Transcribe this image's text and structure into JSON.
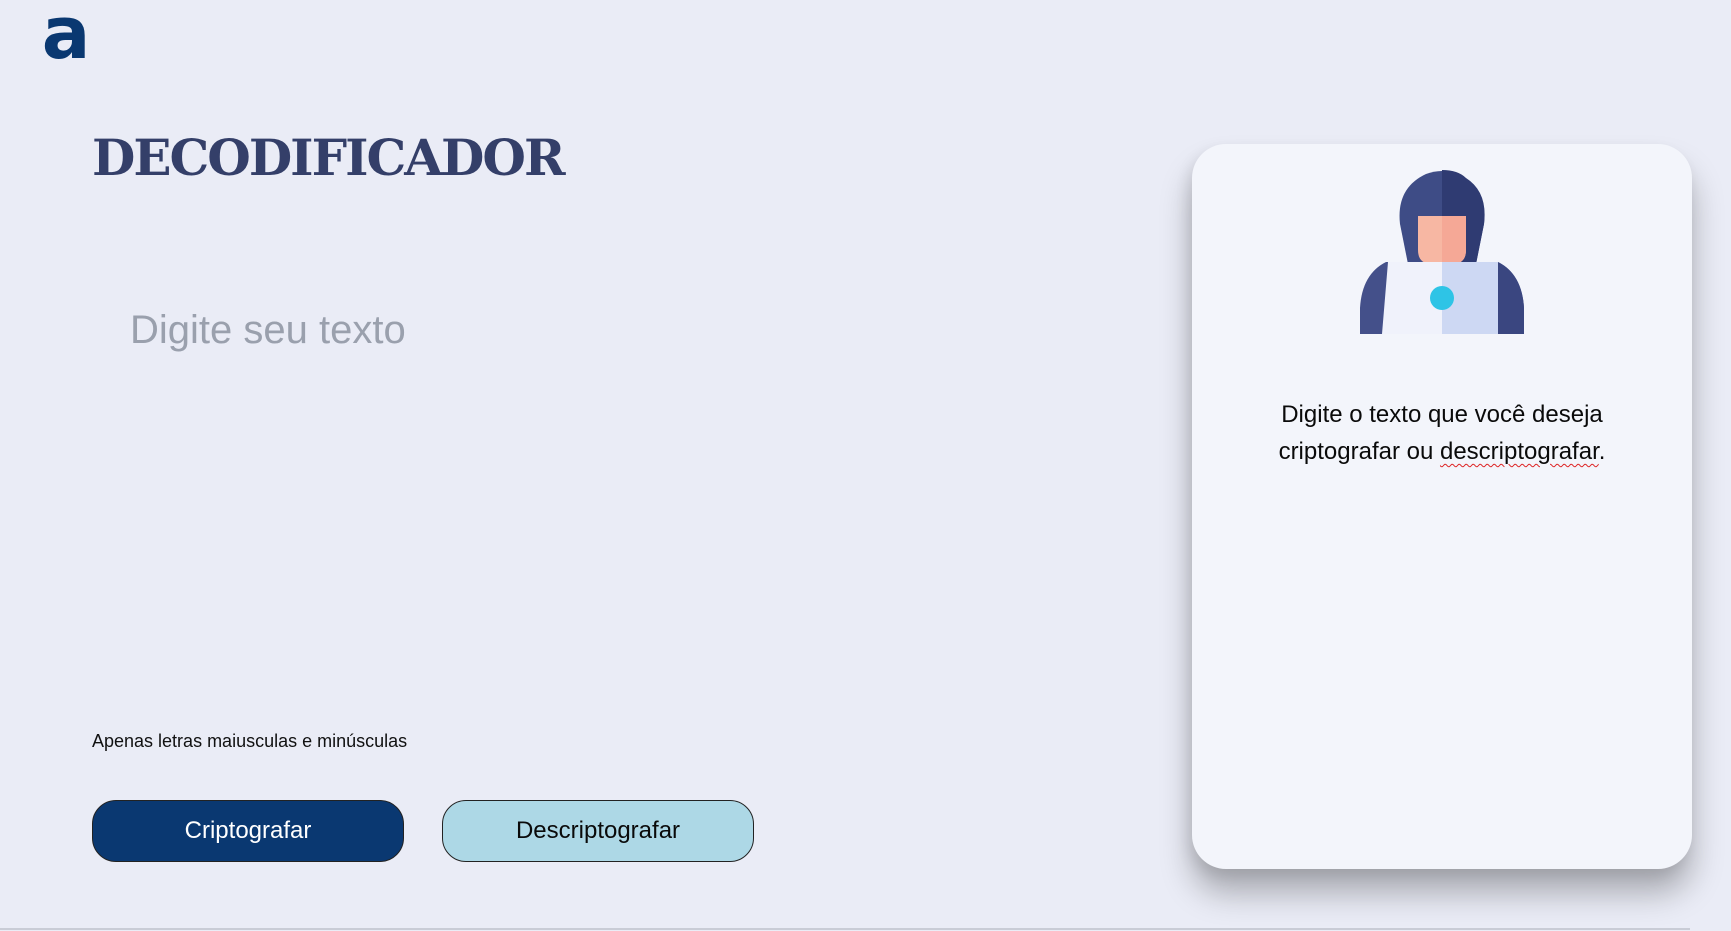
{
  "logo": {
    "glyph": "a",
    "icon": "alura-logo-icon",
    "color": "#0a3871"
  },
  "main": {
    "title": "DECODIFICADOR",
    "input_placeholder": "Digite seu texto",
    "input_value": "",
    "hint": "Apenas letras maiusculas e minúsculas",
    "buttons": {
      "encrypt_label": "Criptografar",
      "decrypt_label": "Descriptografar"
    }
  },
  "output_card": {
    "illustration": "hooded-person-with-laptop-icon",
    "message_part1": "Digite o texto que você deseja criptografar ou ",
    "message_misspelled": "descriptografar",
    "message_end": "."
  },
  "colors": {
    "background": "#eaecf6",
    "primary": "#0a3871",
    "secondary_button": "#add8e6",
    "title": "#343f69",
    "card": "#f3f5fb"
  }
}
